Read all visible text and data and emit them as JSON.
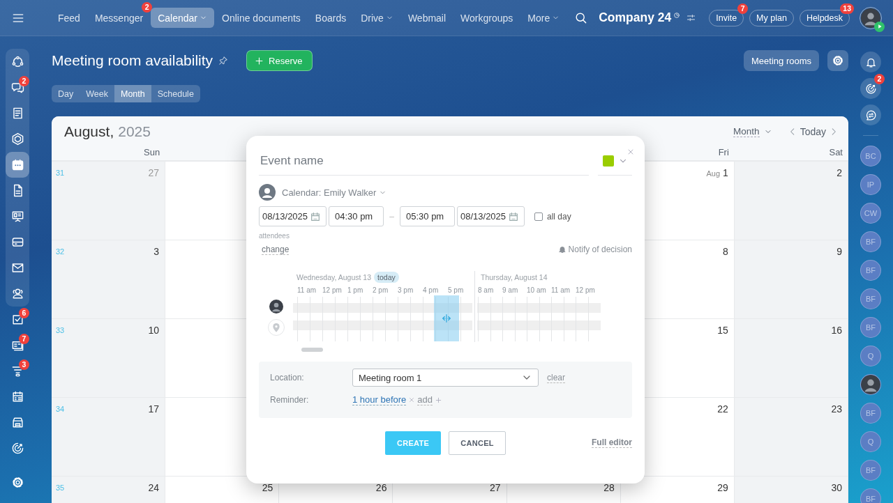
{
  "topbar": {
    "nav": [
      {
        "label": "Feed",
        "selected": false,
        "dropdown": false
      },
      {
        "label": "Messenger",
        "selected": false,
        "dropdown": false,
        "badge": "2"
      },
      {
        "label": "Calendar",
        "selected": true,
        "dropdown": true
      },
      {
        "label": "Online documents",
        "selected": false,
        "dropdown": false
      },
      {
        "label": "Boards",
        "selected": false,
        "dropdown": false
      },
      {
        "label": "Drive",
        "selected": false,
        "dropdown": true
      },
      {
        "label": "Webmail",
        "selected": false,
        "dropdown": false
      },
      {
        "label": "Workgroups",
        "selected": false,
        "dropdown": false
      },
      {
        "label": "More",
        "selected": false,
        "dropdown": true
      }
    ],
    "company": "Company 24",
    "buttons": [
      {
        "label": "Invite",
        "badge": "7"
      },
      {
        "label": "My plan"
      },
      {
        "label": "Helpdesk",
        "badge": "13"
      }
    ]
  },
  "left_sidebar": {
    "pinned_items": [
      {
        "kind": "hub",
        "selected": false
      },
      {
        "kind": "chat",
        "selected": false,
        "badge": "2"
      },
      {
        "kind": "feed",
        "selected": false
      },
      {
        "kind": "hexagon",
        "selected": false
      },
      {
        "kind": "calendar",
        "selected": true
      },
      {
        "kind": "document",
        "selected": false
      },
      {
        "kind": "board",
        "selected": false
      },
      {
        "kind": "drive",
        "selected": false
      },
      {
        "kind": "mail",
        "selected": false
      },
      {
        "kind": "people",
        "selected": false
      }
    ],
    "items": [
      {
        "kind": "tasks",
        "selected": false,
        "badge": "6"
      },
      {
        "kind": "contacts",
        "selected": false,
        "badge": "7"
      },
      {
        "kind": "funnel",
        "selected": false,
        "badge": "3"
      },
      {
        "kind": "schedule",
        "selected": false
      },
      {
        "kind": "store",
        "selected": false
      },
      {
        "kind": "target",
        "selected": false
      },
      {
        "kind": "settings",
        "selected": false
      }
    ]
  },
  "right_sidebar": {
    "actions": [
      {
        "kind": "bell"
      },
      {
        "kind": "target",
        "badge": "2"
      },
      {
        "kind": "chats"
      }
    ],
    "contacts": [
      {
        "kind": "initials",
        "initials": "BC"
      },
      {
        "kind": "initials",
        "initials": "IP"
      },
      {
        "kind": "initials",
        "initials": "CW"
      },
      {
        "kind": "initials",
        "initials": "BF"
      },
      {
        "kind": "initials",
        "initials": "BF"
      },
      {
        "kind": "initials",
        "initials": "BF"
      },
      {
        "kind": "initials",
        "initials": "BF"
      },
      {
        "kind": "initials",
        "initials": "Q"
      },
      {
        "kind": "photo"
      },
      {
        "kind": "initials",
        "initials": "BF"
      },
      {
        "kind": "initials",
        "initials": "Q"
      },
      {
        "kind": "initials",
        "initials": "BF"
      },
      {
        "kind": "initials",
        "initials": "BF"
      }
    ]
  },
  "page": {
    "title": "Meeting room availability",
    "reserve_button": "Reserve",
    "views": [
      {
        "label": "Day",
        "selected": false
      },
      {
        "label": "Week",
        "selected": false
      },
      {
        "label": "Month",
        "selected": true
      },
      {
        "label": "Schedule",
        "selected": false
      }
    ],
    "meeting_rooms_button": "Meeting rooms"
  },
  "calendar": {
    "month": "August,",
    "year": "2025",
    "view_select": "Month",
    "today_button": "Today",
    "columns": [
      {
        "label": "Sun",
        "weekend": true
      },
      {
        "label": "Fri",
        "weekend": false
      },
      {
        "label": "Sat",
        "weekend": true
      }
    ],
    "weeks": [
      {
        "number": "31",
        "days": [
          {
            "day": "27",
            "muted": true
          },
          {
            "month": "Aug",
            "day": "1",
            "muted": false
          },
          {
            "day": "2",
            "muted": false
          }
        ]
      },
      {
        "number": "32",
        "days": [
          {
            "day": "3",
            "muted": false
          },
          {
            "day": "8",
            "muted": false
          },
          {
            "day": "9",
            "muted": false
          }
        ]
      },
      {
        "number": "33",
        "days": [
          {
            "day": "10",
            "muted": false
          },
          {
            "day": "15",
            "muted": false
          },
          {
            "day": "16",
            "muted": false
          }
        ]
      },
      {
        "number": "34",
        "days": [
          {
            "day": "17",
            "muted": false
          },
          {
            "day": "22",
            "muted": false
          },
          {
            "day": "23",
            "muted": false
          }
        ]
      },
      {
        "number": "35",
        "days": [
          {
            "day": "24",
            "muted": false
          },
          {
            "day": "25",
            "muted": false
          },
          {
            "day": "26",
            "muted": false
          },
          {
            "day": "27",
            "muted": false
          },
          {
            "day": "28",
            "muted": false
          },
          {
            "day": "29",
            "muted": false
          },
          {
            "day": "30",
            "muted": false
          }
        ]
      }
    ]
  },
  "event_popup": {
    "name_placeholder": "Event name",
    "color": "#9acd00",
    "calendar": "Calendar: Emily Walker",
    "start_date": "08/13/2025",
    "start_time": "04:30 pm",
    "separator": "–",
    "end_time": "05:30 pm",
    "end_date": "08/13/2025",
    "all_day": {
      "label": "all day",
      "checked": false
    },
    "attendees_label": "attendees",
    "change_link": "change",
    "notify": "Notify of decision",
    "planner": {
      "days": [
        {
          "label": "Wednesday, August 13",
          "today_label": "today",
          "hours": [
            "11 am",
            "12 pm",
            "1 pm",
            "2 pm",
            "3 pm",
            "4 pm",
            "5 pm"
          ]
        },
        {
          "label": "Thursday, August 14",
          "hours": [
            "8 am",
            "9 am",
            "10 am",
            "11 am",
            "12 pm"
          ]
        }
      ],
      "rows": [
        {
          "kind": "user"
        },
        {
          "kind": "location"
        }
      ]
    },
    "location": {
      "label": "Location:",
      "value": "Meeting room 1",
      "clear": "clear"
    },
    "reminder": {
      "label": "Reminder:",
      "value": "1 hour before",
      "add": "add"
    },
    "create_button": "CREATE",
    "cancel_button": "CANCEL",
    "full_editor": "Full editor"
  }
}
